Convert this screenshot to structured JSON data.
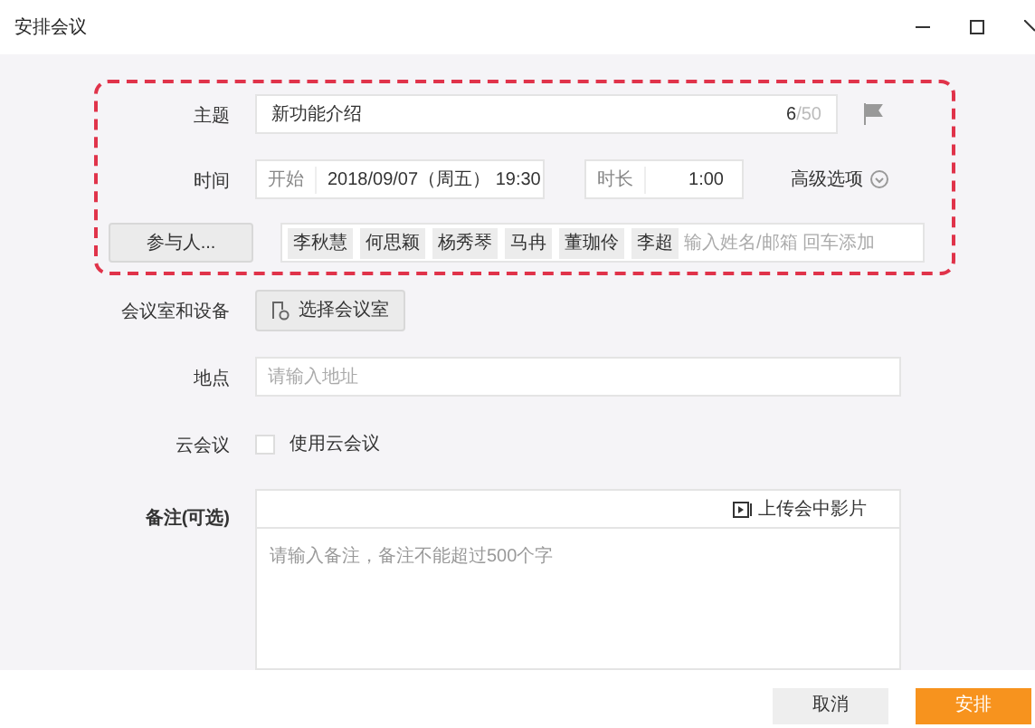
{
  "window": {
    "title": "安排会议"
  },
  "subject": {
    "label": "主题",
    "value": "新功能介绍",
    "count": "6",
    "max": "/50"
  },
  "time": {
    "label": "时间",
    "start_label": "开始",
    "start_value": "2018/09/07（周五） 19:30",
    "duration_label": "时长",
    "duration_value": "1:00",
    "advanced": "高级选项"
  },
  "attendees": {
    "button": "参与人...",
    "people": [
      "李秋慧",
      "何思颖",
      "杨秀琴",
      "马冉",
      "董珈伶",
      "李超"
    ],
    "placeholder": "输入姓名/邮箱 回车添加"
  },
  "room": {
    "label": "会议室和设备",
    "button": "选择会议室"
  },
  "location": {
    "label": "地点",
    "placeholder": "请输入地址"
  },
  "cloud": {
    "label": "云会议",
    "option": "使用云会议",
    "checked": false
  },
  "notes": {
    "label": "备注(可选)",
    "upload": "上传会中影片",
    "placeholder": "请输入备注，备注不能超过500个字"
  },
  "buttons": {
    "cancel": "取消",
    "confirm": "安排"
  }
}
